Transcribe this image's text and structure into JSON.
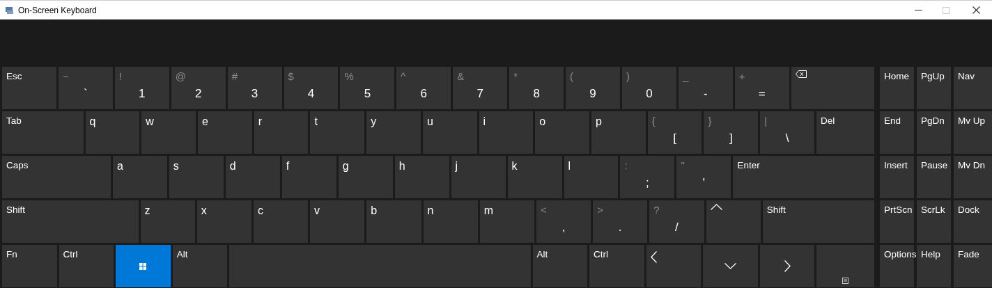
{
  "window": {
    "title": "On-Screen Keyboard"
  },
  "main_rows": [
    {
      "keys": [
        {
          "kind": "text",
          "label": "Esc",
          "pressed": false
        },
        {
          "kind": "char",
          "shift": "~",
          "label": "`",
          "pressed": false
        },
        {
          "kind": "char",
          "shift": "!",
          "label": "1",
          "pressed": false
        },
        {
          "kind": "char",
          "shift": "@",
          "label": "2",
          "pressed": false
        },
        {
          "kind": "char",
          "shift": "#",
          "label": "3",
          "pressed": false
        },
        {
          "kind": "char",
          "shift": "$",
          "label": "4",
          "pressed": false
        },
        {
          "kind": "char",
          "shift": "%",
          "label": "5",
          "pressed": false
        },
        {
          "kind": "char",
          "shift": "^",
          "label": "6",
          "pressed": false
        },
        {
          "kind": "char",
          "shift": "&",
          "label": "7",
          "pressed": false
        },
        {
          "kind": "char",
          "shift": "*",
          "label": "8",
          "pressed": false
        },
        {
          "kind": "char",
          "shift": "(",
          "label": "9",
          "pressed": false
        },
        {
          "kind": "char",
          "shift": ")",
          "label": "0",
          "pressed": false
        },
        {
          "kind": "char",
          "shift": "_",
          "label": "-",
          "pressed": false
        },
        {
          "kind": "char",
          "shift": "+",
          "label": "=",
          "pressed": false
        },
        {
          "kind": "backspace",
          "pressed": false
        }
      ]
    },
    {
      "keys": [
        {
          "kind": "text",
          "label": "Tab",
          "pressed": false
        },
        {
          "kind": "letter",
          "label": "q",
          "pressed": false
        },
        {
          "kind": "letter",
          "label": "w",
          "pressed": false
        },
        {
          "kind": "letter",
          "label": "e",
          "pressed": false
        },
        {
          "kind": "letter",
          "label": "r",
          "pressed": false
        },
        {
          "kind": "letter",
          "label": "t",
          "pressed": false
        },
        {
          "kind": "letter",
          "label": "y",
          "pressed": false
        },
        {
          "kind": "letter",
          "label": "u",
          "pressed": false
        },
        {
          "kind": "letter",
          "label": "i",
          "pressed": false
        },
        {
          "kind": "letter",
          "label": "o",
          "pressed": false
        },
        {
          "kind": "letter",
          "label": "p",
          "pressed": false
        },
        {
          "kind": "char",
          "shift": "{",
          "label": "[",
          "pressed": false
        },
        {
          "kind": "char",
          "shift": "}",
          "label": "]",
          "pressed": false
        },
        {
          "kind": "char",
          "shift": "|",
          "label": "\\",
          "pressed": false
        },
        {
          "kind": "text",
          "label": "Del",
          "pressed": false
        }
      ]
    },
    {
      "keys": [
        {
          "kind": "text",
          "label": "Caps",
          "pressed": false
        },
        {
          "kind": "letter",
          "label": "a",
          "pressed": false
        },
        {
          "kind": "letter",
          "label": "s",
          "pressed": false
        },
        {
          "kind": "letter",
          "label": "d",
          "pressed": false
        },
        {
          "kind": "letter",
          "label": "f",
          "pressed": false
        },
        {
          "kind": "letter",
          "label": "g",
          "pressed": false
        },
        {
          "kind": "letter",
          "label": "h",
          "pressed": false
        },
        {
          "kind": "letter",
          "label": "j",
          "pressed": false
        },
        {
          "kind": "letter",
          "label": "k",
          "pressed": false
        },
        {
          "kind": "letter",
          "label": "l",
          "pressed": false
        },
        {
          "kind": "char",
          "shift": ":",
          "label": ";",
          "pressed": false
        },
        {
          "kind": "char",
          "shift": "\"",
          "label": "'",
          "pressed": false
        },
        {
          "kind": "text",
          "label": "Enter",
          "pressed": false
        }
      ]
    },
    {
      "keys": [
        {
          "kind": "text",
          "label": "Shift",
          "pressed": false
        },
        {
          "kind": "letter",
          "label": "z",
          "pressed": false
        },
        {
          "kind": "letter",
          "label": "x",
          "pressed": false
        },
        {
          "kind": "letter",
          "label": "c",
          "pressed": false
        },
        {
          "kind": "letter",
          "label": "v",
          "pressed": false
        },
        {
          "kind": "letter",
          "label": "b",
          "pressed": false
        },
        {
          "kind": "letter",
          "label": "n",
          "pressed": false
        },
        {
          "kind": "letter",
          "label": "m",
          "pressed": false
        },
        {
          "kind": "char",
          "shift": "<",
          "label": ",",
          "pressed": false
        },
        {
          "kind": "char",
          "shift": ">",
          "label": ".",
          "pressed": false
        },
        {
          "kind": "char",
          "shift": "?",
          "label": "/",
          "pressed": false
        },
        {
          "kind": "uparrow",
          "pressed": false
        },
        {
          "kind": "text",
          "label": "Shift",
          "pressed": false
        }
      ]
    },
    {
      "keys": [
        {
          "kind": "text",
          "label": "Fn",
          "pressed": false
        },
        {
          "kind": "text",
          "label": "Ctrl",
          "pressed": false
        },
        {
          "kind": "windows",
          "pressed": true
        },
        {
          "kind": "text",
          "label": "Alt",
          "pressed": false
        },
        {
          "kind": "blank",
          "pressed": false
        },
        {
          "kind": "text",
          "label": "Alt",
          "pressed": false
        },
        {
          "kind": "text",
          "label": "Ctrl",
          "pressed": false
        },
        {
          "kind": "leftarrow",
          "pressed": false
        },
        {
          "kind": "downarrow",
          "pressed": false
        },
        {
          "kind": "rightarrow",
          "pressed": false
        },
        {
          "kind": "menu",
          "pressed": false
        }
      ]
    }
  ],
  "side_rows": [
    {
      "keys": [
        {
          "kind": "text",
          "label": "Home",
          "pressed": false
        },
        {
          "kind": "text",
          "label": "PgUp",
          "pressed": false
        },
        {
          "kind": "text",
          "label": "Nav",
          "pressed": false
        }
      ]
    },
    {
      "keys": [
        {
          "kind": "text",
          "label": "End",
          "pressed": false
        },
        {
          "kind": "text",
          "label": "PgDn",
          "pressed": false
        },
        {
          "kind": "text",
          "label": "Mv Up",
          "pressed": false
        }
      ]
    },
    {
      "keys": [
        {
          "kind": "text",
          "label": "Insert",
          "pressed": false
        },
        {
          "kind": "text",
          "label": "Pause",
          "pressed": false
        },
        {
          "kind": "text",
          "label": "Mv Dn",
          "pressed": false
        }
      ]
    },
    {
      "keys": [
        {
          "kind": "text",
          "label": "PrtScn",
          "pressed": false
        },
        {
          "kind": "text",
          "label": "ScrLk",
          "pressed": false
        },
        {
          "kind": "text",
          "label": "Dock",
          "pressed": false
        }
      ]
    },
    {
      "keys": [
        {
          "kind": "text",
          "label": "Options",
          "pressed": false
        },
        {
          "kind": "text",
          "label": "Help",
          "pressed": false
        },
        {
          "kind": "text",
          "label": "Fade",
          "pressed": false
        }
      ]
    }
  ]
}
